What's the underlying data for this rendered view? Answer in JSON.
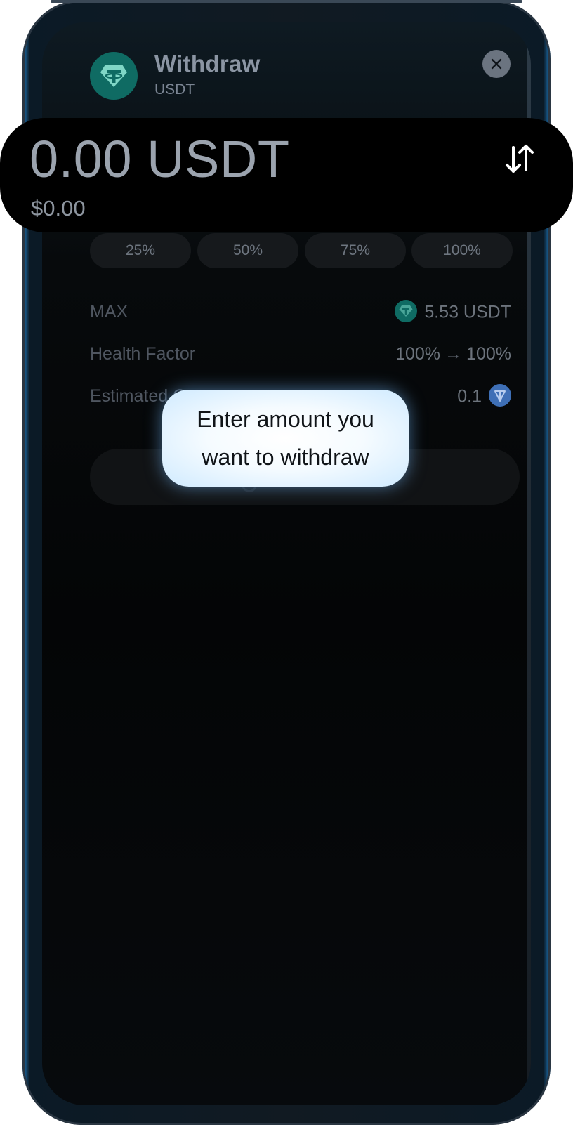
{
  "header": {
    "title": "Withdraw",
    "subtitle": "USDT"
  },
  "amount": {
    "value": "0.00 USDT",
    "usd": "$0.00"
  },
  "percent_buttons": [
    "25%",
    "50%",
    "75%",
    "100%"
  ],
  "info": {
    "max_label": "MAX",
    "max_value": "5.53 USDT",
    "health_label": "Health Factor",
    "health_from": "100%",
    "health_arrow": "→",
    "health_to": "100%",
    "estimated_label": "Estimated G",
    "estimated_value": "0.1"
  },
  "tooltip": {
    "text": "Enter amount you want to withdraw"
  },
  "icons": {
    "token_logo": "tether-icon",
    "close": "close-icon",
    "swap": "swap-arrows-icon",
    "ton": "ton-icon"
  },
  "colors": {
    "tether": "#0f6b63",
    "ton": "#3e6fb6",
    "tooltip_glow": "#cfeaff"
  }
}
